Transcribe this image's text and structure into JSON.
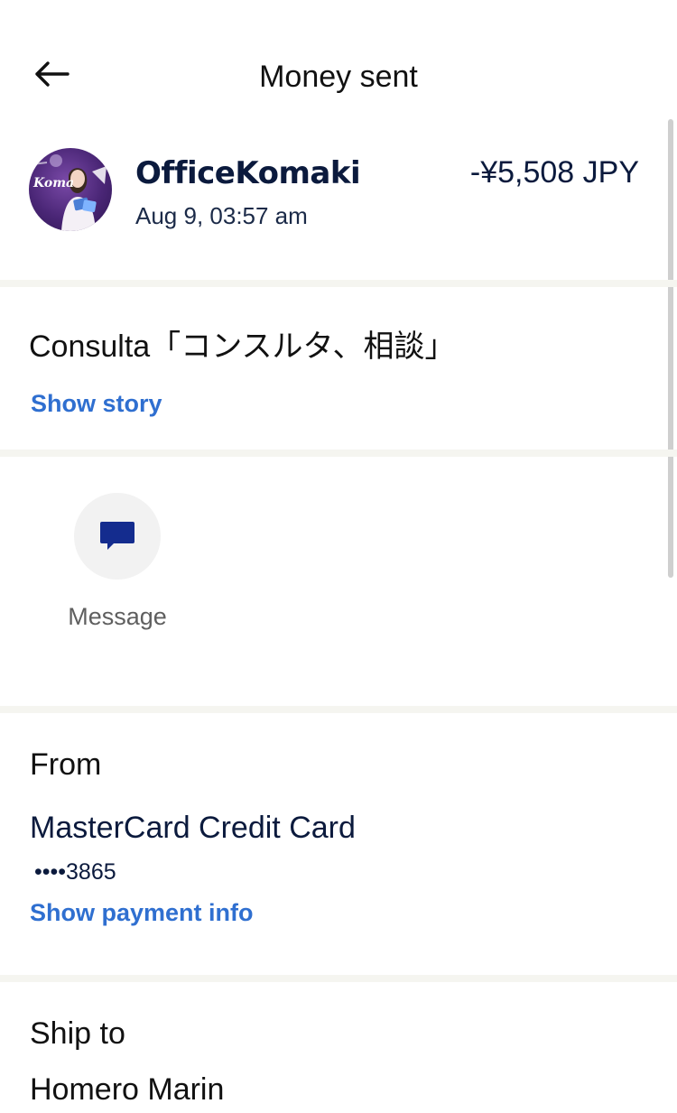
{
  "header": {
    "title": "Money sent",
    "back_icon": "arrow-left-icon"
  },
  "transaction": {
    "merchant_name": "OfficeKomaki",
    "datetime": "Aug 9, 03:57 am",
    "amount": "-¥5,508 JPY",
    "avatar_text": "Koma"
  },
  "note": {
    "text": "Consulta「コンスルタ、相談」",
    "show_story_label": "Show story"
  },
  "actions": {
    "message_label": "Message",
    "message_icon": "chat-bubble-icon"
  },
  "from": {
    "heading": "From",
    "card_name": "MasterCard Credit Card",
    "card_number": "••••3865",
    "show_payment_label": "Show payment info"
  },
  "ship_to": {
    "heading": "Ship to",
    "name": "Homero Marin"
  },
  "colors": {
    "link": "#2f6fd0",
    "navy_text": "#0b1a3d",
    "divider": "#f5f5f0",
    "message_icon": "#142c8e"
  }
}
